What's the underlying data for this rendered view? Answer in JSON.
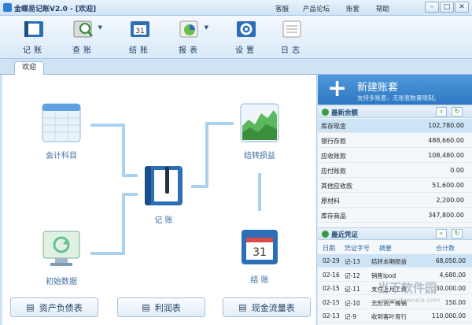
{
  "window": {
    "title": "金蝶易记账V2.0 - [欢迎]",
    "links": [
      "客服",
      "产品论坛",
      "账套",
      "帮助"
    ],
    "controls": [
      "–",
      "□",
      "✕"
    ]
  },
  "toolbar": {
    "items": [
      {
        "label": "记账",
        "icon": "journal-icon"
      },
      {
        "label": "查账",
        "icon": "search-ledger-icon"
      },
      {
        "label": "结账",
        "icon": "calendar-icon"
      },
      {
        "label": "报表",
        "icon": "chart-icon"
      },
      {
        "label": "设置",
        "icon": "gear-icon"
      },
      {
        "label": "日志",
        "icon": "log-icon"
      }
    ]
  },
  "tabs": [
    {
      "label": "欢迎"
    }
  ],
  "flow": {
    "accounts": "会计科目",
    "initial": "初始数据",
    "record": "记  账",
    "transfer": "结转损益",
    "close": "结  账"
  },
  "bottom_buttons": [
    "资产负债表",
    "利润表",
    "现金流量表"
  ],
  "sidebar": {
    "new_account": {
      "title": "新建账套",
      "subtitle": "支持多账套，无账套数量限制。"
    },
    "balance": {
      "title": "最新余额",
      "rows": [
        {
          "name": "库存现金",
          "value": "102,780.00"
        },
        {
          "name": "银行存款",
          "value": "488,660.00"
        },
        {
          "name": "应收账款",
          "value": "108,480.00"
        },
        {
          "name": "应付账款",
          "value": "0.00"
        },
        {
          "name": "其他应收款",
          "value": "51,600.00"
        },
        {
          "name": "原材料",
          "value": "2,200.00"
        },
        {
          "name": "库存商品",
          "value": "347,800.00"
        }
      ]
    },
    "vouchers": {
      "title": "最近凭证",
      "headers": [
        "日期",
        "凭证字号",
        "摘要",
        "合计数"
      ],
      "rows": [
        {
          "date": "02-29",
          "no": "记-13",
          "memo": "结转本期损益",
          "total": "68,050.00"
        },
        {
          "date": "02-16",
          "no": "记-12",
          "memo": "销售Ipod",
          "total": "4,680.00"
        },
        {
          "date": "02-15",
          "no": "记-11",
          "memo": "支付上月工资",
          "total": "30,000.00"
        },
        {
          "date": "02-15",
          "no": "记-10",
          "memo": "无形资产摊销",
          "total": "150.00"
        },
        {
          "date": "02-13",
          "no": "记-9",
          "memo": "收到客叶育行",
          "total": "110,000.00"
        }
      ]
    }
  },
  "watermark": {
    "text": "当下软件园",
    "url": "www.downxia.com"
  },
  "colors": {
    "accent": "#2f78c2",
    "flow_label": "#3c6ea5",
    "arrow": "#a9d2f2"
  }
}
